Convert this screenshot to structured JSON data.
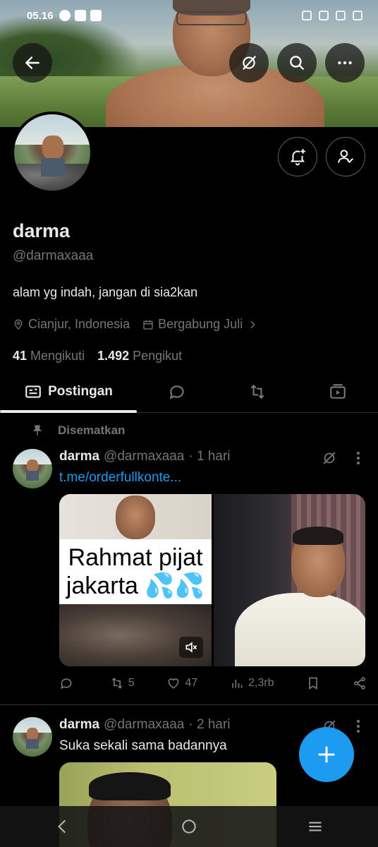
{
  "status_bar": {
    "time": "05.16"
  },
  "profile": {
    "name": "darma",
    "handle": "@darmaxaaa",
    "bio": "alam yg indah, jangan di sia2kan",
    "location": "Cianjur, Indonesia",
    "joined": "Bergabung Juli",
    "following_count": "41",
    "following_label": "Mengikuti",
    "followers_count": "1.492",
    "followers_label": "Pengikut"
  },
  "tabs": [
    {
      "label": "Postingan",
      "icon": "posts-icon",
      "active": true
    },
    {
      "label": "",
      "icon": "replies-icon"
    },
    {
      "label": "",
      "icon": "repost-icon"
    },
    {
      "label": "",
      "icon": "media-icon"
    }
  ],
  "pinned_label": "Disematkan",
  "posts": [
    {
      "name": "darma",
      "handle": "@darmaxaaa",
      "time": "· 1 hari",
      "text": "t.me/orderfullkonte...",
      "media_caption": "Rahmat pijat jakarta 💦💦",
      "replies": "",
      "reposts": "5",
      "likes": "47",
      "views": "2,3rb"
    },
    {
      "name": "darma",
      "handle": "@darmaxaaa",
      "time": "· 2 hari",
      "text": "Suka sekali sama badannya"
    }
  ],
  "colors": {
    "accent": "#1d9bf0",
    "background": "#000000",
    "secondary_text": "#71767b"
  }
}
